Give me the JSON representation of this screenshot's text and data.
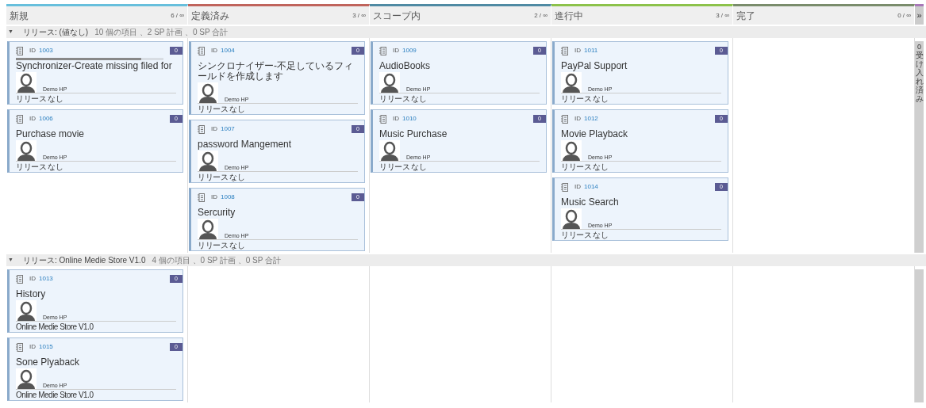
{
  "columns": [
    {
      "title": "新規",
      "count": "6 / ∞",
      "color": "#67bfdc"
    },
    {
      "title": "定義済み",
      "count": "3 / ∞",
      "color": "#c0645c"
    },
    {
      "title": "スコープ内",
      "count": "2 / ∞",
      "color": "#4f8aa3"
    },
    {
      "title": "進行中",
      "count": "3 / ∞",
      "color": "#8cc24a"
    },
    {
      "title": "完了",
      "count": "0 / ∞",
      "color": "#7a8c6c"
    }
  ],
  "collapsed_column": {
    "title": "受け入れ済み",
    "count": "0",
    "color": "#a877b8",
    "expand_button": "»"
  },
  "lanes": [
    {
      "toggle": "▼",
      "title": "リリース: (値なし)",
      "summary": "10 個の項目 、2 SP 計画 、0 SP 合計",
      "expanded": true,
      "cells": [
        [
          {
            "id_label": "ID",
            "id": "1003",
            "points": "0",
            "title": "Synchronizer-Create missing filed for",
            "owner": "Demo HP",
            "release": "リリース なし",
            "level": 0.85
          },
          {
            "id_label": "ID",
            "id": "1006",
            "points": "0",
            "title": "Purchase movie",
            "owner": "Demo HP",
            "release": "リリース なし"
          }
        ],
        [
          {
            "id_label": "ID",
            "id": "1004",
            "points": "0",
            "title": "シンクロナイザー-不足しているフィールドを作成します",
            "owner": "Demo HP",
            "release": "リリース なし"
          },
          {
            "id_label": "ID",
            "id": "1007",
            "points": "0",
            "title": "password Mangement",
            "owner": "Demo HP",
            "release": "リリース なし"
          },
          {
            "id_label": "ID",
            "id": "1008",
            "points": "0",
            "title": "Sercurity",
            "owner": "Demo HP",
            "release": "リリース なし"
          }
        ],
        [
          {
            "id_label": "ID",
            "id": "1009",
            "points": "0",
            "title": "AudioBooks",
            "owner": "Demo HP",
            "release": "リリース なし"
          },
          {
            "id_label": "ID",
            "id": "1010",
            "points": "0",
            "title": "Music Purchase",
            "owner": "Demo HP",
            "release": "リリース なし"
          }
        ],
        [
          {
            "id_label": "ID",
            "id": "1011",
            "points": "0",
            "title": "PayPal Support",
            "owner": "Demo HP",
            "release": "リリース なし"
          },
          {
            "id_label": "ID",
            "id": "1012",
            "points": "0",
            "title": "Movie Playback",
            "owner": "Demo HP",
            "release": "リリース なし"
          },
          {
            "id_label": "ID",
            "id": "1014",
            "points": "0",
            "title": "Music Search",
            "owner": "Demo HP",
            "release": "リリース なし"
          }
        ],
        []
      ]
    },
    {
      "toggle": "▼",
      "title": "リリース: Online Medie Store V1.0",
      "summary": "4 個の項目 、0 SP 計画 、0 SP 合計",
      "expanded": true,
      "cells": [
        [
          {
            "id_label": "ID",
            "id": "1013",
            "points": "0",
            "title": "History",
            "owner": "Demo HP",
            "release": "Online Medie Store V1.0"
          },
          {
            "id_label": "ID",
            "id": "1015",
            "points": "0",
            "title": "Sone Plyaback",
            "owner": "Demo HP",
            "release": "Online Medie Store V1.0"
          }
        ],
        [],
        [],
        [],
        []
      ]
    }
  ]
}
